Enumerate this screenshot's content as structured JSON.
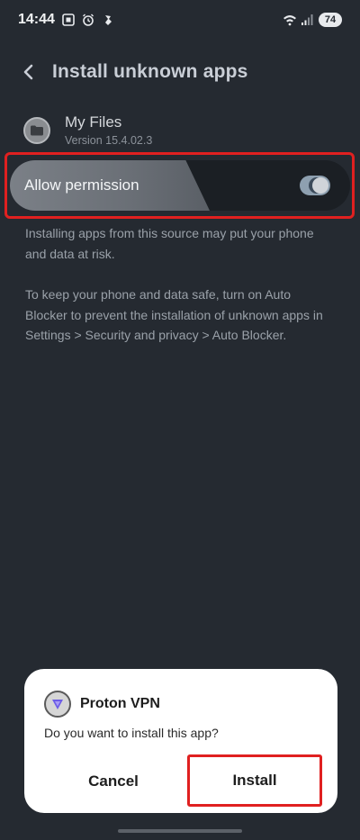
{
  "status_bar": {
    "time": "14:44",
    "battery": "74",
    "icons": [
      "screenshot-icon",
      "alarm-icon",
      "notification-icon",
      "wifi-icon",
      "signal-icon"
    ]
  },
  "header": {
    "title": "Install unknown apps",
    "back_icon": "chevron-left-icon"
  },
  "source_app": {
    "name": "My Files",
    "version": "Version 15.4.02.3",
    "icon": "folder-icon"
  },
  "permission": {
    "label": "Allow permission",
    "enabled": true
  },
  "warnings": {
    "line1": "Installing apps from this source may put your phone and data at risk.",
    "line2": "To keep your phone and data safe, turn on Auto Blocker to prevent the installation of unknown apps in Settings > Security and privacy > Auto Blocker."
  },
  "dialog": {
    "app_name": "Proton VPN",
    "question": "Do you want to install this app?",
    "cancel_label": "Cancel",
    "install_label": "Install"
  },
  "colors": {
    "background": "#252a31",
    "highlight": "#e02020",
    "dialog_bg": "#ffffff"
  }
}
